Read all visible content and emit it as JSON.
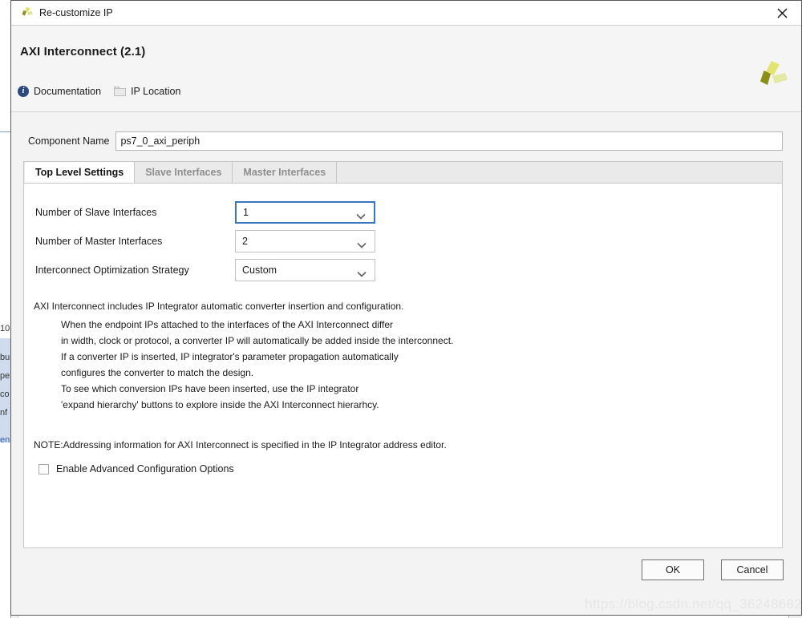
{
  "window": {
    "title": "Re-customize IP",
    "logo_icon": "xilinx-logo-icon",
    "close_icon": "close-icon"
  },
  "header": {
    "ip_title": "AXI Interconnect (2.1)",
    "logo_icon": "xilinx-logo-icon",
    "links": [
      {
        "label": "Documentation",
        "icon": "info-icon"
      },
      {
        "label": "IP Location",
        "icon": "folder-icon"
      }
    ]
  },
  "component": {
    "label": "Component Name",
    "value": "ps7_0_axi_periph",
    "placeholder": "Component Name"
  },
  "tabs": [
    {
      "label": "Top Level Settings",
      "active": true
    },
    {
      "label": "Slave Interfaces",
      "active": false
    },
    {
      "label": "Master Interfaces",
      "active": false
    }
  ],
  "settings": [
    {
      "label": "Number of Slave Interfaces",
      "value": "1",
      "focused": true
    },
    {
      "label": "Number of Master Interfaces",
      "value": "2",
      "focused": false
    },
    {
      "label": "Interconnect Optimization Strategy",
      "value": "Custom",
      "focused": false
    }
  ],
  "description": {
    "lead": "AXI Interconnect includes IP Integrator automatic converter insertion and configuration.",
    "lines": [
      "When the endpoint IPs attached to the interfaces of the AXI Interconnect differ",
      "in width, clock or protocol, a converter IP will automatically be added inside the interconnect.",
      "If a converter IP is inserted, IP integrator's parameter propagation automatically",
      "configures the converter to match the design.",
      "To see which conversion IPs have been inserted, use the IP integrator",
      "'expand hierarchy' buttons to explore inside the AXI Interconnect hierarhcy."
    ],
    "note": "NOTE:Addressing information for AXI Interconnect is specified in the IP Integrator address editor."
  },
  "advanced_checkbox": {
    "label": "Enable Advanced Configuration Options",
    "checked": false
  },
  "footer": {
    "ok_label": "OK",
    "cancel_label": "Cancel"
  },
  "watermark": {
    "text": "https://blog.csdn.net/qq_36248682"
  },
  "background": {
    "fragments": [
      "10",
      "bu",
      "pe",
      "co",
      "nf",
      "en"
    ]
  },
  "colors": {
    "focus_blue": "#3a76c4",
    "logo_yellow": "#e8ea7c",
    "logo_olive": "#8c8f16",
    "dialog_bg": "#f3f3f3",
    "panel_white": "#ffffff",
    "tab_inactive": "#8e8e8e"
  }
}
